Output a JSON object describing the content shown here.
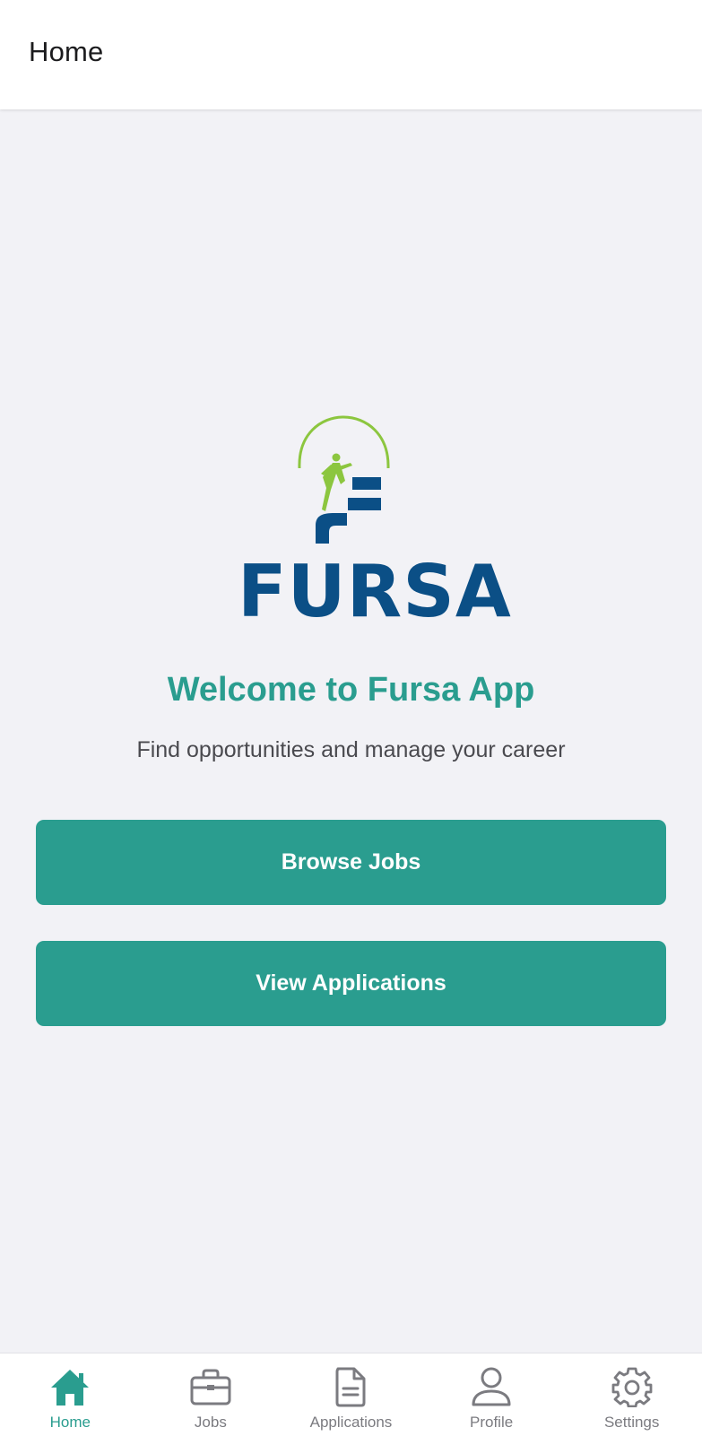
{
  "header": {
    "title": "Home"
  },
  "logo": {
    "wordmark": "FURSA"
  },
  "main": {
    "welcome": "Welcome to Fursa App",
    "subtitle": "Find opportunities and manage your career",
    "browse_label": "Browse Jobs",
    "applications_label": "View Applications"
  },
  "tabbar": {
    "active": "Home",
    "items": [
      {
        "label": "Home",
        "icon": "home-icon"
      },
      {
        "label": "Jobs",
        "icon": "briefcase-icon"
      },
      {
        "label": "Applications",
        "icon": "document-icon"
      },
      {
        "label": "Profile",
        "icon": "person-icon"
      },
      {
        "label": "Settings",
        "icon": "gear-icon"
      }
    ]
  },
  "colors": {
    "accent": "#2a9d8f",
    "logo_blue": "#0b4f86",
    "logo_green": "#8cc63f",
    "background": "#f2f2f6",
    "inactive": "#7b7b80"
  }
}
